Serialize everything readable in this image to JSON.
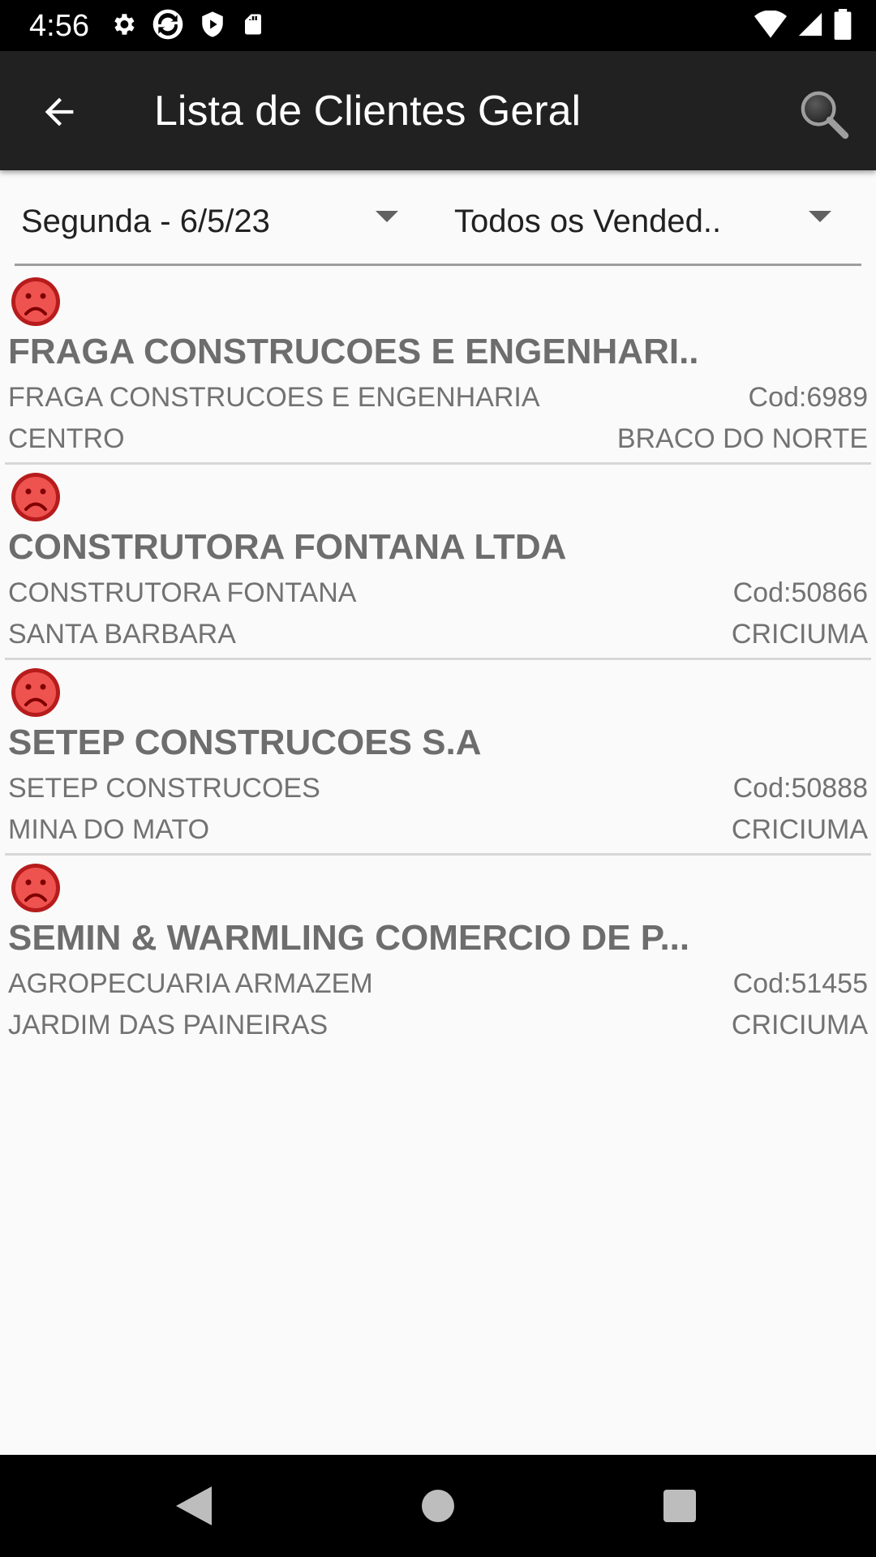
{
  "status_bar": {
    "time": "4:56",
    "icons": [
      "gear-icon",
      "sync-icon",
      "shield-icon",
      "sd-card-icon",
      "wifi-icon",
      "signal-icon",
      "battery-icon"
    ]
  },
  "toolbar": {
    "title": "Lista de Clientes Geral",
    "back_icon": "arrow-back-icon",
    "search_icon": "search-icon",
    "background": "#212121"
  },
  "filters": {
    "date": "Segunda - 6/5/23",
    "seller": "Todos os Vended.."
  },
  "clients": [
    {
      "status_icon": "sad-face-icon",
      "name": "FRAGA CONSTRUCOES E ENGENHARI...",
      "trade_name": "FRAGA CONSTRUCOES E ENGENHARIA",
      "code": "Cod:6989",
      "neighborhood": "CENTRO",
      "city": "BRACO DO NORTE"
    },
    {
      "status_icon": "sad-face-icon",
      "name": "CONSTRUTORA FONTANA LTDA",
      "trade_name": "CONSTRUTORA FONTANA",
      "code": "Cod:50866",
      "neighborhood": "SANTA BARBARA",
      "city": "CRICIUMA"
    },
    {
      "status_icon": "sad-face-icon",
      "name": "SETEP CONSTRUCOES S.A",
      "trade_name": "SETEP CONSTRUCOES",
      "code": "Cod:50888",
      "neighborhood": "MINA DO MATO",
      "city": "CRICIUMA"
    },
    {
      "status_icon": "sad-face-icon",
      "name": "SEMIN & WARMLING COMERCIO DE P...",
      "trade_name": "AGROPECUARIA ARMAZEM",
      "code": "Cod:51455",
      "neighborhood": "JARDIM DAS PAINEIRAS",
      "city": "CRICIUMA"
    }
  ],
  "nav_bar": {
    "icons": [
      "back-triangle-icon",
      "home-circle-icon",
      "recents-square-icon"
    ]
  },
  "colors": {
    "status_red": "#c62828",
    "text_gray": "#6d6d6d"
  }
}
